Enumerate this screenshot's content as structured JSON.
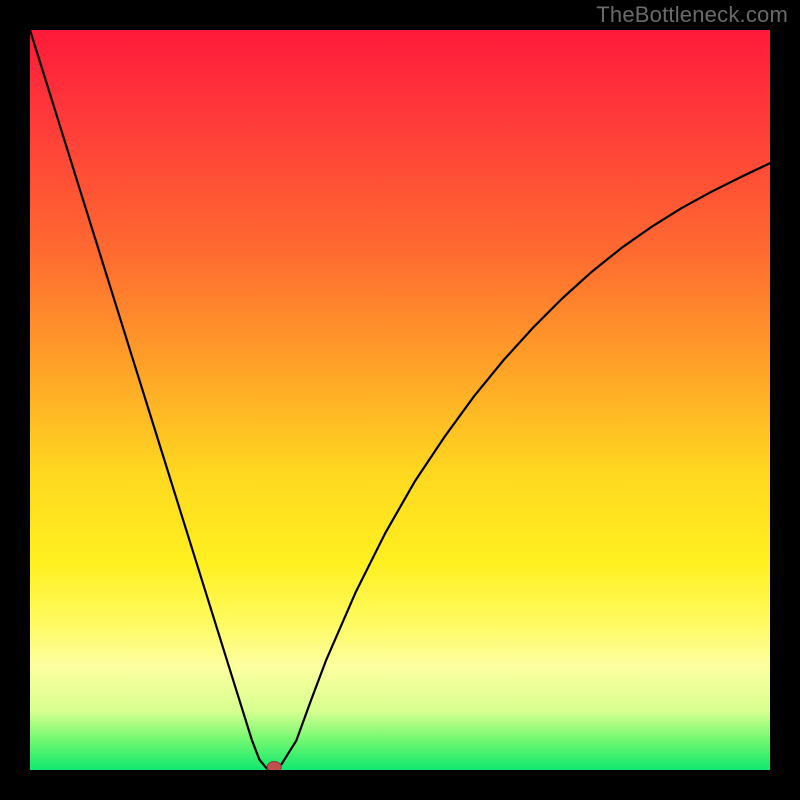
{
  "watermark": "TheBottleneck.com",
  "chart_data": {
    "type": "line",
    "title": "",
    "xlabel": "",
    "ylabel": "",
    "xlim": [
      0,
      100
    ],
    "ylim": [
      0,
      100
    ],
    "gradient_meaning": "vertical color gradient from red (top, high bottleneck) to green (bottom, low bottleneck)",
    "minimum_point": {
      "x": 32,
      "y": 0
    },
    "marker": {
      "x": 33,
      "y": 0,
      "color": "#c0504d"
    },
    "x": [
      0,
      2,
      4,
      6,
      8,
      10,
      12,
      14,
      16,
      18,
      20,
      22,
      24,
      26,
      28,
      29,
      30,
      31,
      32,
      33,
      34,
      36,
      38,
      40,
      44,
      48,
      52,
      56,
      60,
      64,
      68,
      72,
      76,
      80,
      84,
      88,
      92,
      96,
      100
    ],
    "y": [
      100,
      93.6,
      87.2,
      80.8,
      74.4,
      68.0,
      61.6,
      55.2,
      48.8,
      42.4,
      36.0,
      29.6,
      23.2,
      16.8,
      10.4,
      7.2,
      4.0,
      1.4,
      0.2,
      0.2,
      0.8,
      4.0,
      9.5,
      14.8,
      24.0,
      32.0,
      39.0,
      45.0,
      50.5,
      55.4,
      59.8,
      63.8,
      67.4,
      70.6,
      73.4,
      75.9,
      78.1,
      80.1,
      82.0
    ]
  }
}
